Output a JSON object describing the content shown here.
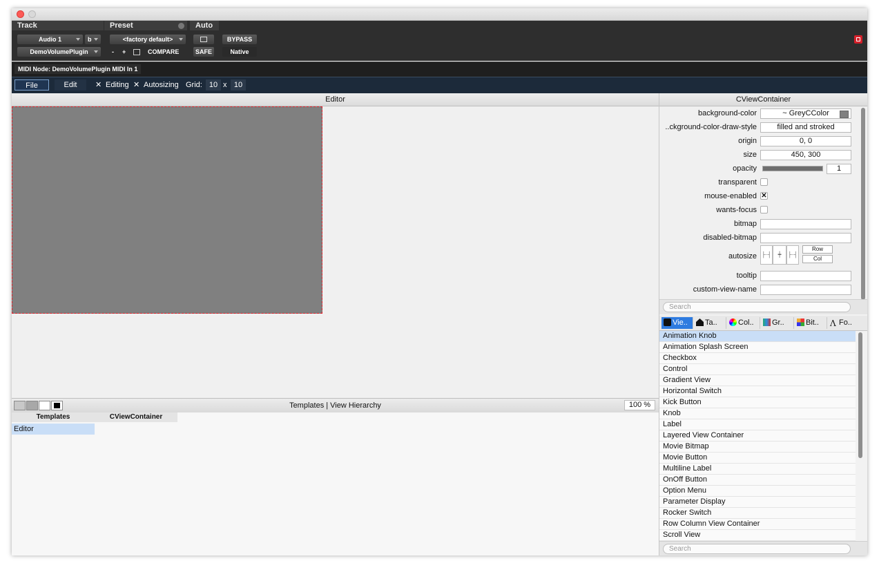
{
  "window": {
    "title": ""
  },
  "pt": {
    "track_header": "Track",
    "preset_header": "Preset",
    "auto_header": "Auto",
    "track_name": "Audio 1",
    "track_letter": "b",
    "plugin_name": "DemoVolumePlugin",
    "preset_name": "<factory default>",
    "minus": "-",
    "plus": "+",
    "compare": "COMPARE",
    "safe": "SAFE",
    "bypass": "BYPASS",
    "native": "Native"
  },
  "midi": {
    "node_label": "MIDI Node: DemoVolumePlugin MIDI In 1"
  },
  "menu": {
    "file": "File",
    "edit": "Edit",
    "editing_mark": "✕",
    "editing": "Editing",
    "autosizing_mark": "✕",
    "autosizing": "Autosizing",
    "grid_label": "Grid:",
    "grid_x": "10",
    "grid_sep": "x",
    "grid_y": "10"
  },
  "editor": {
    "title": "Editor"
  },
  "bottom": {
    "title": "Templates | View Hierarchy",
    "zoom": "100 %"
  },
  "tree": {
    "col1": "Templates",
    "col2": "CViewContainer",
    "row1": "Editor"
  },
  "inspector": {
    "title": "CViewContainer",
    "props": [
      {
        "name": "background-color",
        "value": "~ GreyCColor"
      },
      {
        "name": "..ckground-color-draw-style",
        "value": "filled and stroked"
      },
      {
        "name": "origin",
        "value": "0, 0"
      },
      {
        "name": "size",
        "value": "450, 300"
      },
      {
        "name": "opacity",
        "value": "1"
      },
      {
        "name": "transparent",
        "value": ""
      },
      {
        "name": "mouse-enabled",
        "value": "✕"
      },
      {
        "name": "wants-focus",
        "value": ""
      },
      {
        "name": "bitmap",
        "value": ""
      },
      {
        "name": "disabled-bitmap",
        "value": ""
      },
      {
        "name": "autosize",
        "value": ""
      },
      {
        "name": "tooltip",
        "value": ""
      },
      {
        "name": "custom-view-name",
        "value": ""
      }
    ],
    "opacity_fraction": 1.0,
    "autosize_row": "Row",
    "autosize_col": "Col",
    "search_placeholder": "Search"
  },
  "library": {
    "tabs": [
      {
        "label": "Vie..",
        "icon": "cube-icon"
      },
      {
        "label": "Ta..",
        "icon": "house-icon"
      },
      {
        "label": "Col..",
        "icon": "color-wheel-icon"
      },
      {
        "label": "Gr..",
        "icon": "gradient-icon"
      },
      {
        "label": "Bit..",
        "icon": "bitmap-grid-icon"
      },
      {
        "label": "Fo..",
        "icon": "font-icon"
      }
    ],
    "items": [
      "Animation Knob",
      "Animation Splash Screen",
      "Checkbox",
      "Control",
      "Gradient View",
      "Horizontal Switch",
      "Kick Button",
      "Knob",
      "Label",
      "Layered View Container",
      "Movie Bitmap",
      "Movie Button",
      "Multiline Label",
      "OnOff Button",
      "Option Menu",
      "Parameter Display",
      "Rocker Switch",
      "Row Column View Container",
      "Scroll View"
    ],
    "search_placeholder": "Search"
  },
  "colors": {
    "accent": "#2e7be0",
    "selection": "#c9def7",
    "canvas": "#808080",
    "canvas_border": "#e0202a"
  }
}
